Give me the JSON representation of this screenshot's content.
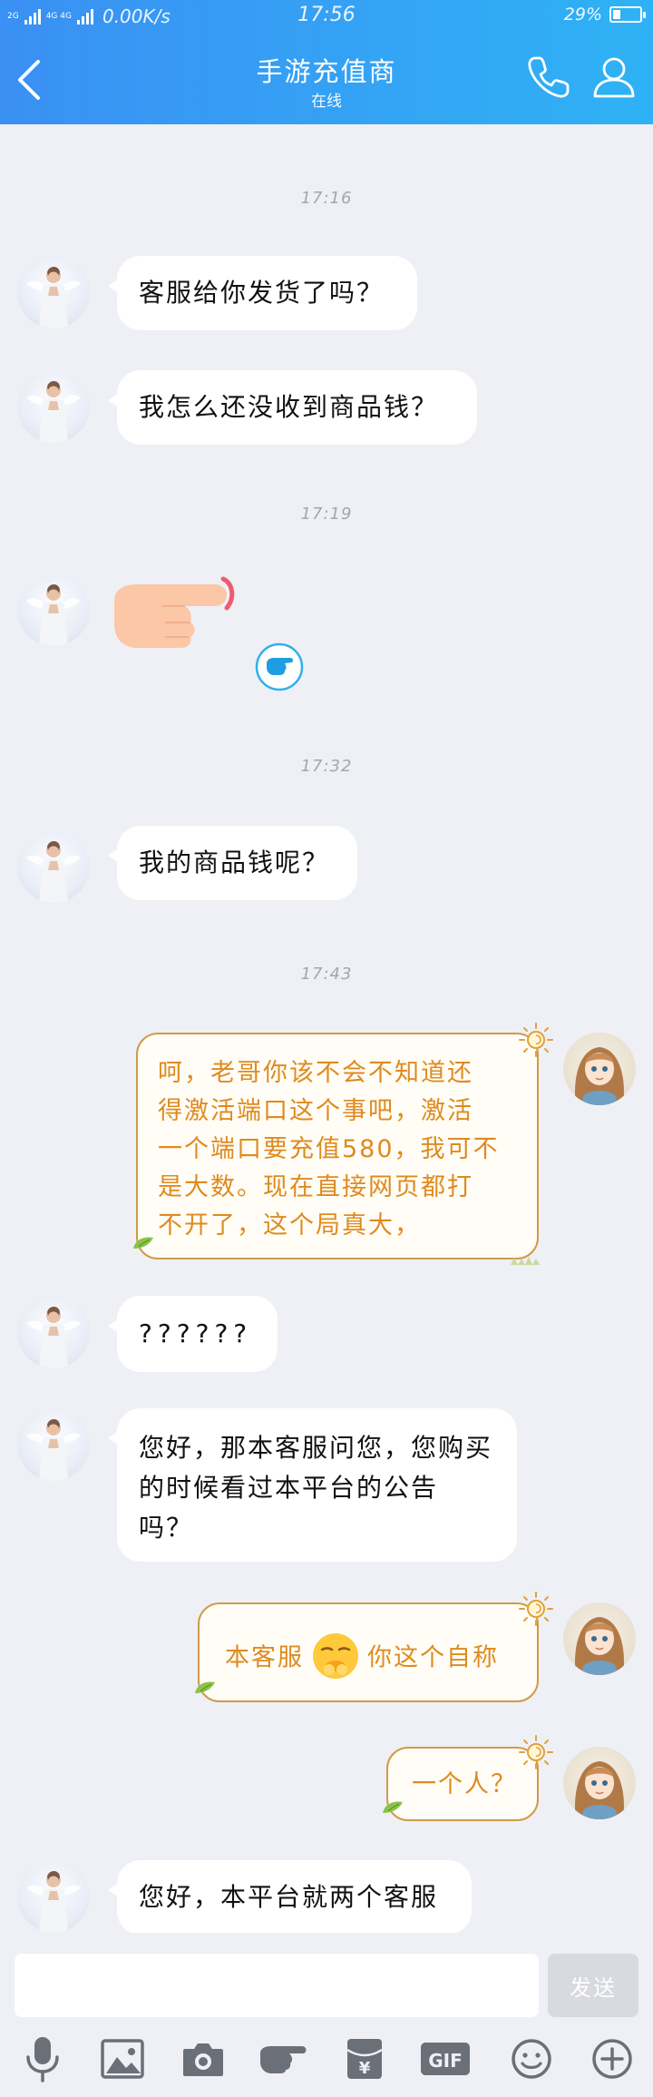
{
  "status_bar": {
    "network_left": "2G",
    "network_mid": "4G 4G",
    "speed": "0.00K/s",
    "time": "17:56",
    "battery": "29%",
    "battery_level": 0.29
  },
  "header": {
    "title": "手游充值商",
    "subtitle": "在线",
    "colors": {
      "gradient_start": "#3a90f3",
      "gradient_end": "#2fb2f5"
    }
  },
  "timestamps": [
    "17:16",
    "17:19",
    "17:32",
    "17:43"
  ],
  "messages": [
    {
      "from": "other",
      "text": "客服给你发货了吗？"
    },
    {
      "from": "other",
      "text": "我怎么还没收到商品钱？"
    },
    {
      "from": "other",
      "type": "sticker",
      "sticker": "pointing-hand-icon"
    },
    {
      "from": "other",
      "text": "我的商品钱呢？"
    },
    {
      "from": "self",
      "lines": [
        "呵，老哥你该不会不知道还",
        "得激活端口这个事吧，激活",
        "一个端口要充值580，我可不",
        "是大数。现在直接网页都打",
        "不开了，这个局真大，"
      ]
    },
    {
      "from": "other",
      "text": "??????"
    },
    {
      "from": "other",
      "lines": [
        "您好，那本客服问您，您购买",
        "的时候看过本平台的公告",
        "吗？"
      ]
    },
    {
      "from": "self",
      "before_emoji": "本客服",
      "emoji": "smirk-face-icon",
      "after_emoji": "你这个自称"
    },
    {
      "from": "self",
      "text": "一个人？"
    },
    {
      "from": "other",
      "text": "您好，本平台就两个客服"
    }
  ],
  "input": {
    "placeholder": "",
    "value": "",
    "send_label": "发送"
  },
  "toolbar": [
    "microphone-icon",
    "image-icon",
    "camera-icon",
    "poke-icon",
    "red-packet-icon",
    "gif-icon",
    "emoji-icon",
    "plus-icon"
  ],
  "colors": {
    "chat_bg": "#eff0f5",
    "bubble_other": "#ffffff",
    "bubble_self_border": "#cf9b48",
    "bubble_self_text": "#e08a1e",
    "timestamp": "#a3a6ae"
  }
}
